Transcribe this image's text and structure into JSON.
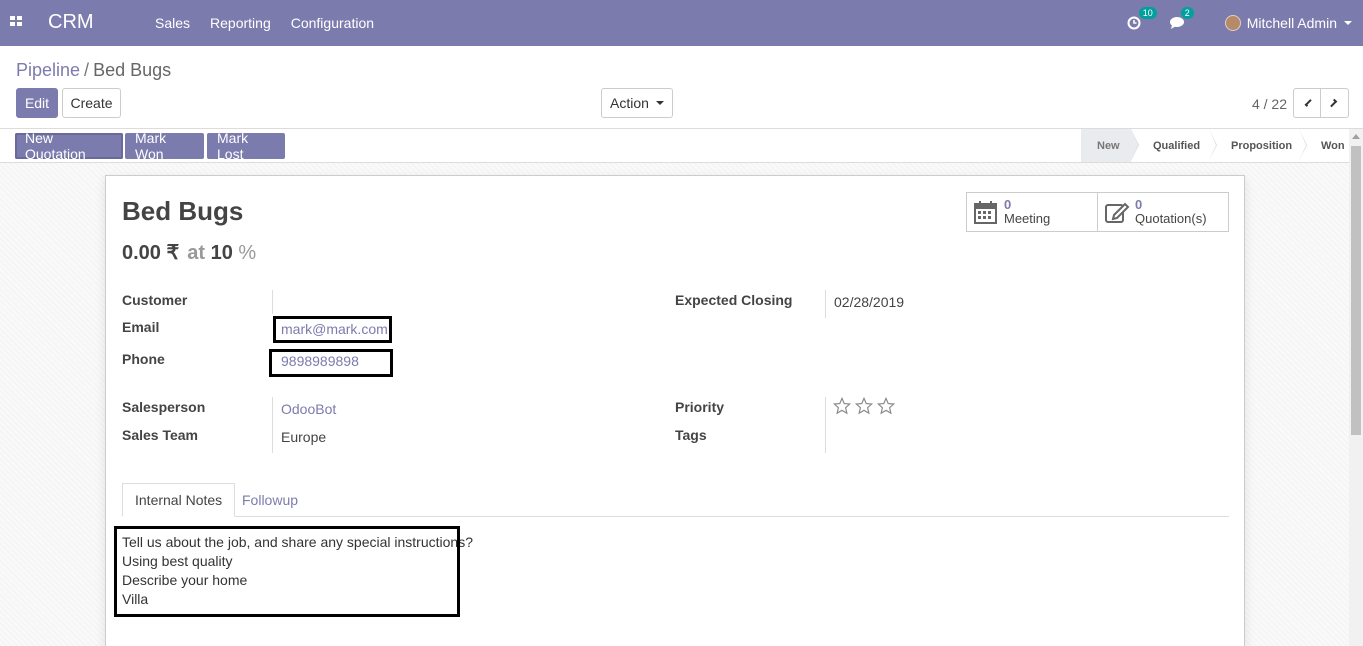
{
  "navbar": {
    "brand": "CRM",
    "menu": [
      "Sales",
      "Reporting",
      "Configuration"
    ],
    "activity_count": "10",
    "message_count": "2",
    "user": "Mitchell Admin"
  },
  "breadcrumb": {
    "parent": "Pipeline",
    "separator": "/",
    "current": "Bed Bugs"
  },
  "buttons": {
    "edit": "Edit",
    "create": "Create",
    "action": "Action"
  },
  "pager": {
    "value": "4 / 22"
  },
  "statusbar": {
    "buttons": [
      "New Quotation",
      "Mark Won",
      "Mark Lost"
    ],
    "stages": [
      "New",
      "Qualified",
      "Proposition",
      "Won"
    ],
    "current_stage": "New"
  },
  "record": {
    "title": "Bed Bugs",
    "revenue": "0.00 ₹",
    "at": "at",
    "probability": "10",
    "percent": "%"
  },
  "smart_buttons": {
    "meeting_count": "0",
    "meeting_label": "Meeting",
    "quotation_count": "0",
    "quotation_label": "Quotation(s)"
  },
  "fields": {
    "customer_label": "Customer",
    "customer_value": "",
    "email_label": "Email",
    "email_value": "mark@mark.com",
    "phone_label": "Phone",
    "phone_value": "9898989898",
    "expected_closing_label": "Expected Closing",
    "expected_closing_value": "02/28/2019",
    "salesperson_label": "Salesperson",
    "salesperson_value": "OdooBot",
    "sales_team_label": "Sales Team",
    "sales_team_value": "Europe",
    "priority_label": "Priority",
    "priority_stars_filled": 0,
    "priority_stars_total": 3,
    "tags_label": "Tags"
  },
  "tabs": {
    "internal_notes": "Internal Notes",
    "followup": "Followup"
  },
  "notes": [
    "Tell us about the job, and share any special instructions?",
    "Using best quality",
    "Describe your home",
    "Villa"
  ],
  "colors": {
    "primary": "#7c7bad",
    "badge": "#00a09d"
  },
  "icons": [
    "apps-grid-icon",
    "activity-clock-icon",
    "chat-bubble-icon",
    "calendar-icon",
    "edit-pencil-icon",
    "star-icon",
    "chevron-left-icon",
    "chevron-right-icon"
  ]
}
